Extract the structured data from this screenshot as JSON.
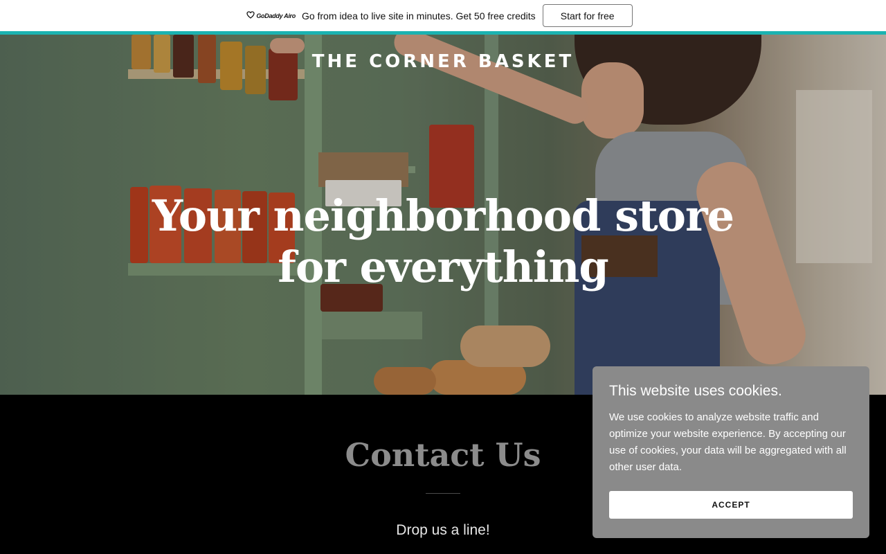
{
  "promo": {
    "logo_text": "GoDaddy Airo",
    "message": "Go from idea to live site in minutes. Get 50 free credits",
    "cta_label": "Start for free",
    "accent_color": "#1bb3b1"
  },
  "hero": {
    "site_title": "THE CORNER BASKET",
    "headline": "Your neighborhood store for everything"
  },
  "contact": {
    "title": "Contact Us",
    "subtitle": "Drop us a line!"
  },
  "cookie_banner": {
    "title": "This website uses cookies.",
    "body": "We use cookies to analyze website traffic and optimize your website experience. By accepting our use of cookies, your data will be aggregated with all other user data.",
    "accept_label": "ACCEPT"
  },
  "icons": {
    "brand_logo": "godaddy-logo-icon"
  }
}
